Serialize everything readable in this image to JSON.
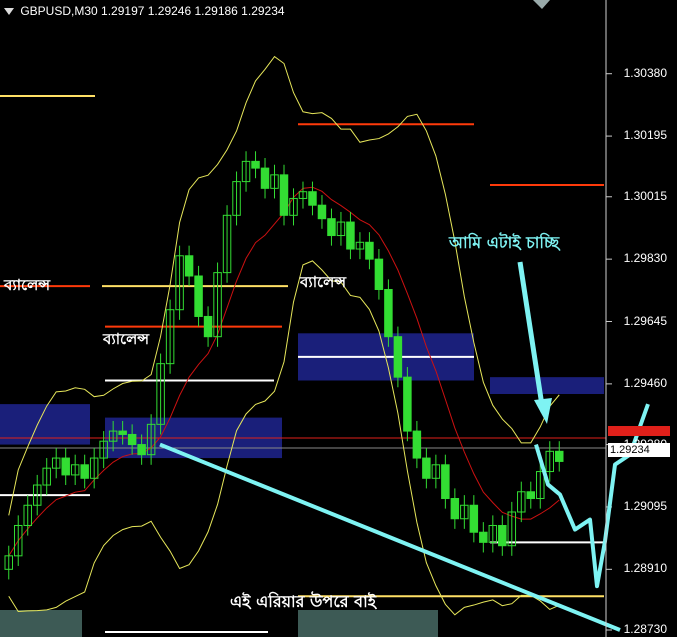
{
  "header": {
    "symbol_tf": "GBPUSD,M30",
    "ohlc": "1.29197 1.29246 1.29186 1.29234"
  },
  "annotations": {
    "balance_1": "ব্যালেন্স",
    "balance_2": "ব্যালেন্স",
    "balance_3": "ব্যালেন্স",
    "want_this": "আমি এটাই চাচ্ছি",
    "buy_above": "এই এরিয়ার উপরে বাই"
  },
  "colors": {
    "background": "#000000",
    "candle": "#33dd33",
    "zone": "#1a1f7a",
    "annotation": "#7ef3f3",
    "bb_upper": "#e6e65a",
    "ma_red": "#cc1111",
    "resistance": "#ff3a0a",
    "support": "#ffffff",
    "level_yellow": "#ffe066",
    "current_price_bg": "#ffffff",
    "alert_bg": "#e0201a"
  },
  "chart_data": {
    "type": "candlestick",
    "symbol": "GBPUSD",
    "timeframe": "M30",
    "ylim": [
      1.2873,
      1.3048
    ],
    "y_ticks": [
      "1.30380",
      "1.30195",
      "1.30015",
      "1.29830",
      "1.29645",
      "1.29460",
      "1.29280",
      "1.29095",
      "1.28910",
      "1.28730"
    ],
    "current_price": "1.29234",
    "close_series": [
      1.2895,
      1.2904,
      1.291,
      1.2916,
      1.2921,
      1.2924,
      1.2919,
      1.2922,
      1.2918,
      1.2924,
      1.2929,
      1.2932,
      1.2931,
      1.2928,
      1.2925,
      1.2934,
      1.2952,
      1.2968,
      1.2984,
      1.2978,
      1.2966,
      1.296,
      1.2979,
      1.2996,
      1.3006,
      1.3012,
      1.301,
      1.3004,
      1.3008,
      1.2996,
      1.3001,
      1.3003,
      1.2999,
      1.2995,
      1.299,
      1.2994,
      1.2986,
      1.2988,
      1.2983,
      1.2974,
      1.296,
      1.2948,
      1.2932,
      1.2924,
      1.2918,
      1.2922,
      1.2912,
      1.2906,
      1.291,
      1.2902,
      1.2899,
      1.2904,
      1.2898,
      1.2908,
      1.2914,
      1.2912,
      1.292,
      1.2926,
      1.2923
    ],
    "levels": [
      {
        "kind": "resistance",
        "price": 1.3023
      },
      {
        "kind": "resistance",
        "price": 1.3005
      },
      {
        "kind": "resistance",
        "price": 1.2975
      },
      {
        "kind": "resistance",
        "price": 1.2963
      },
      {
        "kind": "support",
        "price": 1.2954
      },
      {
        "kind": "support",
        "price": 1.2947
      },
      {
        "kind": "support",
        "price": 1.2913
      },
      {
        "kind": "support",
        "price": 1.2899
      },
      {
        "kind": "level",
        "price": 1.2975
      },
      {
        "kind": "level",
        "price": 1.2883
      }
    ],
    "zones": [
      {
        "price_low": 1.2928,
        "price_high": 1.294
      },
      {
        "price_low": 1.2924,
        "price_high": 1.2936
      },
      {
        "price_low": 1.2947,
        "price_high": 1.2961
      },
      {
        "price_low": 1.2943,
        "price_high": 1.2948
      }
    ],
    "projection": {
      "from_price": 1.2928,
      "low_price": 1.2886,
      "to_price": 1.294
    },
    "trendline": {
      "from_price": 1.2928,
      "to_price": 1.2873
    }
  }
}
